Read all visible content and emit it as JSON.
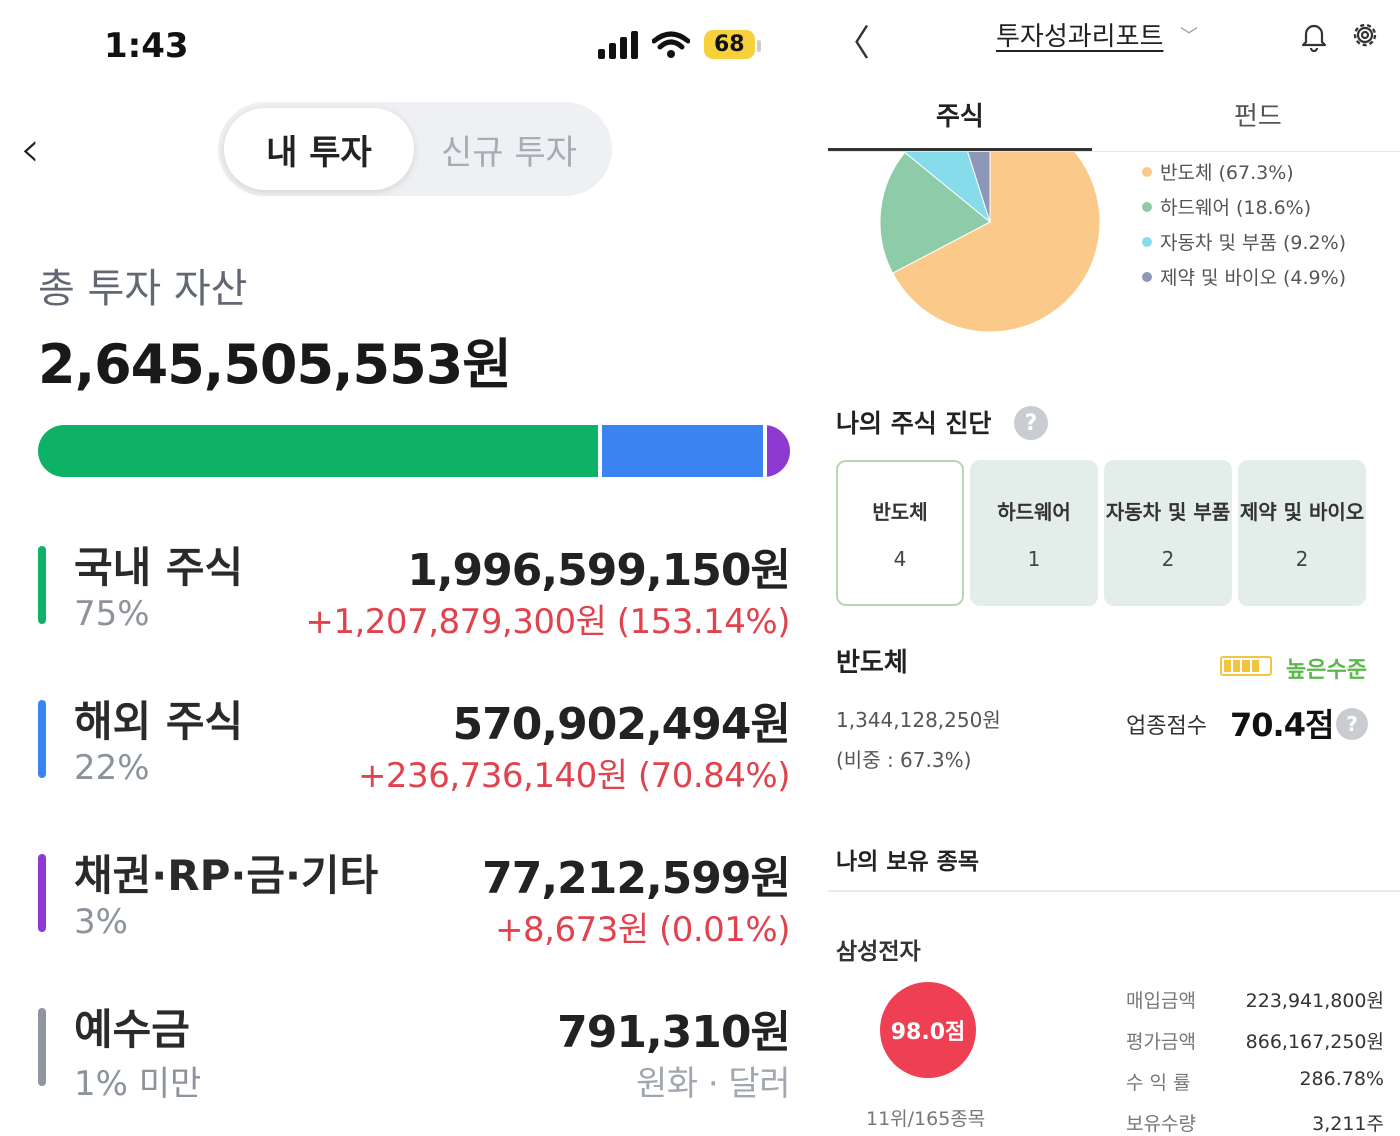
{
  "left": {
    "status": {
      "time": "1:43",
      "battery": "68"
    },
    "segments": {
      "active": "내 투자",
      "inactive": "신규 투자"
    },
    "total_label": "총 투자 자산",
    "total_value": "2,645,505,553원",
    "allocation": [
      {
        "name": "국내 주식",
        "percent": 75,
        "color": "#0eb266"
      },
      {
        "name": "해외 주식",
        "percent": 22,
        "color": "#3a83f1"
      },
      {
        "name": "채권·RP·금·기타",
        "percent": 3,
        "color": "#8e39d1"
      }
    ],
    "assets": [
      {
        "name": "국내 주식",
        "pct": "75%",
        "amount": "1,996,599,150원",
        "change": "+1,207,879,300원 (153.14%)",
        "color": "#0eb266"
      },
      {
        "name": "해외 주식",
        "pct": "22%",
        "amount": "570,902,494원",
        "change": "+236,736,140원 (70.84%)",
        "color": "#3a83f1"
      },
      {
        "name": "채권·RP·금·기타",
        "pct": "3%",
        "amount": "77,212,599원",
        "change": "+8,673원 (0.01%)",
        "color": "#8e39d1"
      },
      {
        "name": "예수금",
        "pct": "1% 미만",
        "amount": "791,310원",
        "change": "원화 · 달러",
        "color": "#8f959d"
      }
    ]
  },
  "right": {
    "title": "투자성과리포트",
    "tabs": {
      "active": "주식",
      "inactive": "펀드"
    },
    "chart_data": {
      "type": "pie",
      "labels": [
        "반도체",
        "하드웨어",
        "자동차 및 부품",
        "제약 및 바이오"
      ],
      "values": [
        67.3,
        18.6,
        9.2,
        4.9
      ],
      "colors": [
        "#fbc98a",
        "#8ecba8",
        "#86dceb",
        "#8d97b8"
      ]
    },
    "legend": [
      {
        "label": "반도체 (67.3%)",
        "color": "#fbc98a"
      },
      {
        "label": "하드웨어 (18.6%)",
        "color": "#8ecba8"
      },
      {
        "label": "자동차 및 부품 (9.2%)",
        "color": "#86dceb"
      },
      {
        "label": "제약 및 바이오 (4.9%)",
        "color": "#8d97b8"
      }
    ],
    "diagnosis_title": "나의 주식 진단",
    "help": "?",
    "cards": [
      {
        "label": "반도체",
        "count": "4"
      },
      {
        "label": "하드웨어",
        "count": "1"
      },
      {
        "label": "자동차 및 부품",
        "count": "2"
      },
      {
        "label": "제약 및 바이오",
        "count": "2"
      }
    ],
    "sector": {
      "name": "반도체",
      "level": "높은수준",
      "level_filled": 4,
      "level_total": 5,
      "amount": "1,344,128,250원",
      "share": "(비중 : 67.3%)",
      "score_label": "업종점수",
      "score_value": "70.4점"
    },
    "holdings_title": "나의 보유 종목",
    "stock": {
      "name": "삼성전자",
      "score": "98.0점",
      "rank": "11위/165종목",
      "details": [
        {
          "k": "매입금액",
          "v": "223,941,800원"
        },
        {
          "k": "평가금액",
          "v": "866,167,250원"
        },
        {
          "k": "수 익 률",
          "v": "286.78%"
        },
        {
          "k": "보유수량",
          "v": "3,211주"
        }
      ]
    }
  }
}
